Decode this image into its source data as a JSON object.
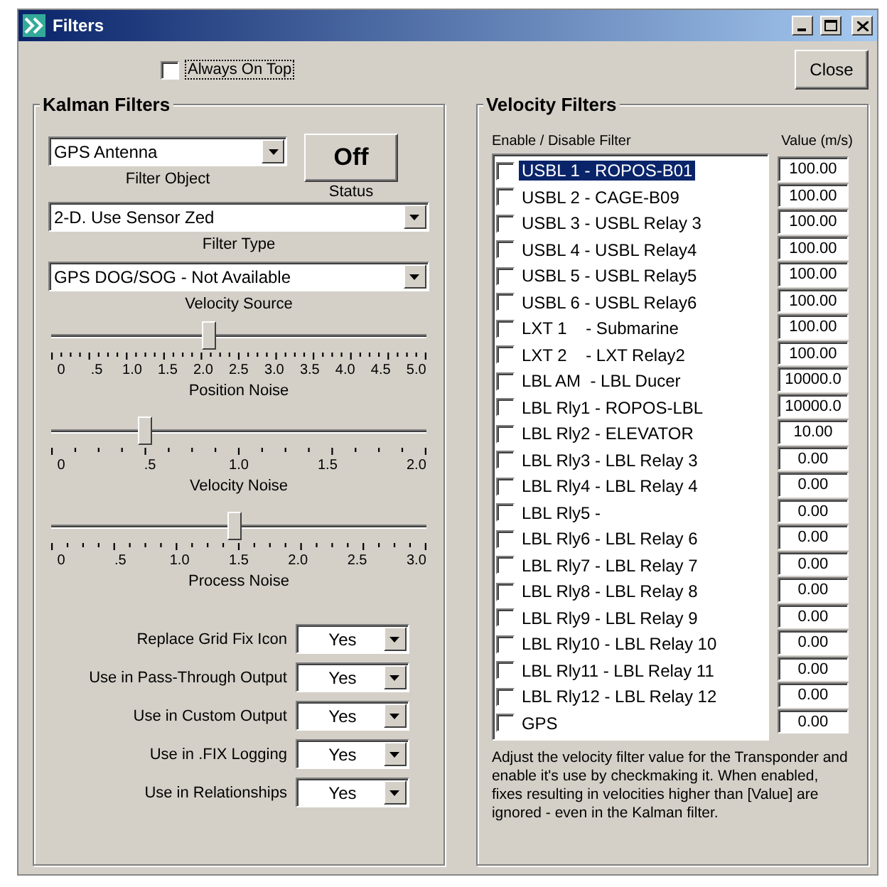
{
  "window": {
    "title": "Filters"
  },
  "always_on_top": {
    "label": "Always On Top",
    "checked": false
  },
  "close_button": "Close",
  "kalman": {
    "title": "Kalman Filters",
    "filter_object": {
      "value": "GPS Antenna",
      "label": "Filter Object"
    },
    "status": {
      "value": "Off",
      "label": "Status"
    },
    "filter_type": {
      "value": "2-D. Use Sensor Zed",
      "label": "Filter Type"
    },
    "velocity_source": {
      "value": "GPS DOG/SOG - Not Available",
      "label": "Velocity Source"
    },
    "sliders": [
      {
        "label": "Position Noise",
        "level": 0.42,
        "ticks": [
          "0",
          ".5",
          "1.0",
          "1.5",
          "2.0",
          "2.5",
          "3.0",
          "3.5",
          "4.0",
          "4.5",
          "5.0"
        ]
      },
      {
        "label": "Velocity Noise",
        "level": 0.25,
        "ticks": [
          "0",
          ".5",
          "1.0",
          "1.5",
          "2.0"
        ]
      },
      {
        "label": "Process Noise",
        "level": 0.49,
        "ticks": [
          "0",
          ".5",
          "1.0",
          "1.5",
          "2.0",
          "2.5",
          "3.0"
        ]
      }
    ],
    "options": [
      {
        "label": "Replace Grid Fix Icon",
        "value": "Yes"
      },
      {
        "label": "Use in Pass-Through Output",
        "value": "Yes"
      },
      {
        "label": "Use in Custom Output",
        "value": "Yes"
      },
      {
        "label": "Use in .FIX Logging",
        "value": "Yes"
      },
      {
        "label": "Use in Relationships",
        "value": "Yes"
      }
    ]
  },
  "velocity": {
    "title": "Velocity Filters",
    "columns": [
      "Enable / Disable Filter",
      "Value (m/s)"
    ],
    "rows": [
      {
        "name": "USBL 1 - ROPOS-B01",
        "checked": false,
        "selected": true,
        "value": "100.00"
      },
      {
        "name": "USBL 2 - CAGE-B09",
        "checked": false,
        "selected": false,
        "value": "100.00"
      },
      {
        "name": "USBL 3 - USBL Relay 3",
        "checked": false,
        "selected": false,
        "value": "100.00"
      },
      {
        "name": "USBL 4 - USBL Relay4",
        "checked": false,
        "selected": false,
        "value": "100.00"
      },
      {
        "name": "USBL 5 - USBL Relay5",
        "checked": false,
        "selected": false,
        "value": "100.00"
      },
      {
        "name": "USBL 6 - USBL Relay6",
        "checked": false,
        "selected": false,
        "value": "100.00"
      },
      {
        "name": "LXT 1    - Submarine",
        "checked": false,
        "selected": false,
        "value": "100.00"
      },
      {
        "name": "LXT 2    - LXT Relay2",
        "checked": false,
        "selected": false,
        "value": "100.00"
      },
      {
        "name": "LBL AM  - LBL Ducer",
        "checked": false,
        "selected": false,
        "value": "10000.0"
      },
      {
        "name": "LBL Rly1 - ROPOS-LBL",
        "checked": false,
        "selected": false,
        "value": "10000.0"
      },
      {
        "name": "LBL Rly2 - ELEVATOR",
        "checked": false,
        "selected": false,
        "value": "10.00"
      },
      {
        "name": "LBL Rly3 - LBL Relay 3",
        "checked": false,
        "selected": false,
        "value": "0.00"
      },
      {
        "name": "LBL Rly4 - LBL Relay 4",
        "checked": false,
        "selected": false,
        "value": "0.00"
      },
      {
        "name": "LBL Rly5 -",
        "checked": false,
        "selected": false,
        "value": "0.00"
      },
      {
        "name": "LBL Rly6 - LBL Relay 6",
        "checked": false,
        "selected": false,
        "value": "0.00"
      },
      {
        "name": "LBL Rly7 - LBL Relay 7",
        "checked": false,
        "selected": false,
        "value": "0.00"
      },
      {
        "name": "LBL Rly8 - LBL Relay 8",
        "checked": false,
        "selected": false,
        "value": "0.00"
      },
      {
        "name": "LBL Rly9 - LBL Relay 9",
        "checked": false,
        "selected": false,
        "value": "0.00"
      },
      {
        "name": "LBL Rly10 - LBL Relay 10",
        "checked": false,
        "selected": false,
        "value": "0.00"
      },
      {
        "name": "LBL Rly11 - LBL Relay 11",
        "checked": false,
        "selected": false,
        "value": "0.00"
      },
      {
        "name": "LBL Rly12 - LBL Relay 12",
        "checked": false,
        "selected": false,
        "value": "0.00"
      },
      {
        "name": "GPS",
        "checked": false,
        "selected": false,
        "value": "0.00"
      }
    ],
    "note": "Adjust the velocity filter value for the Transponder and enable it's use by checkmaking it. When enabled, fixes resulting in velocities higher than [Value] are ignored - even in the Kalman filter."
  }
}
